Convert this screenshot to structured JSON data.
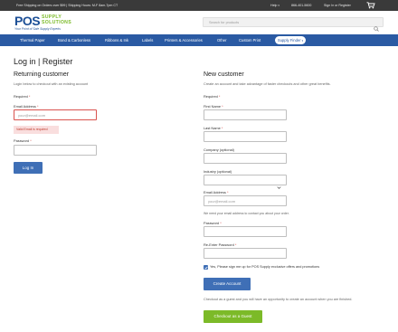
{
  "topbar": {
    "promo": "Free Shipping on Orders over $99 | Shipping Hours: M-F 8am-7pm CT",
    "help": "Help",
    "phone": "866-401-5600",
    "signin": "Sign In or Register",
    "cart_icon": "cart-icon"
  },
  "header": {
    "logo_pos": "POS",
    "logo_supply": "SUPPLY",
    "logo_solutions": "SOLUTIONS",
    "logo_tagline": "Your Point of Sale Supply Experts",
    "search_placeholder": "Search for products",
    "search_icon": "search-icon"
  },
  "nav": {
    "items": [
      "Thermal Paper",
      "Bond & Carbonless",
      "Ribbons & Ink",
      "Labels",
      "Printers & Accessories",
      "Other",
      "Custom Print"
    ],
    "finder": "Supply Finder"
  },
  "page": {
    "title": "Log in | Register"
  },
  "login": {
    "heading": "Returning customer",
    "subtext": "Login below to checkout with an existing account",
    "required": "Required",
    "email_label": "Email Address",
    "email_placeholder": "your@email.com",
    "email_error": "Valid Email is required",
    "password_label": "Password",
    "login_button": "Log In"
  },
  "register": {
    "heading": "New customer",
    "subtext": "Create an account and take advantage of faster checkouts and other great benefits.",
    "required": "Required",
    "first_name_label": "First Name",
    "last_name_label": "Last Name",
    "company_label": "Company (optional)",
    "industry_label": "Industry (optional)",
    "email_label": "Email Address",
    "email_placeholder": "your@email.com",
    "email_help": "We need your email address to contact you about your order.",
    "password_label": "Password",
    "reenter_label": "Re-Enter Password",
    "signup_text": "Yes, Please sign me up for POS Supply exclusive offers and promotions",
    "create_button": "Create Account",
    "guest_text": "Checkout as a guest and you will have an opportunity to create an account when you are finished.",
    "guest_button": "Checkout as a Guest"
  },
  "colors": {
    "brand_blue": "#2a5aa3",
    "button_blue": "#3f6fb6",
    "brand_green": "#7cba28",
    "error_red": "#d9534f"
  }
}
